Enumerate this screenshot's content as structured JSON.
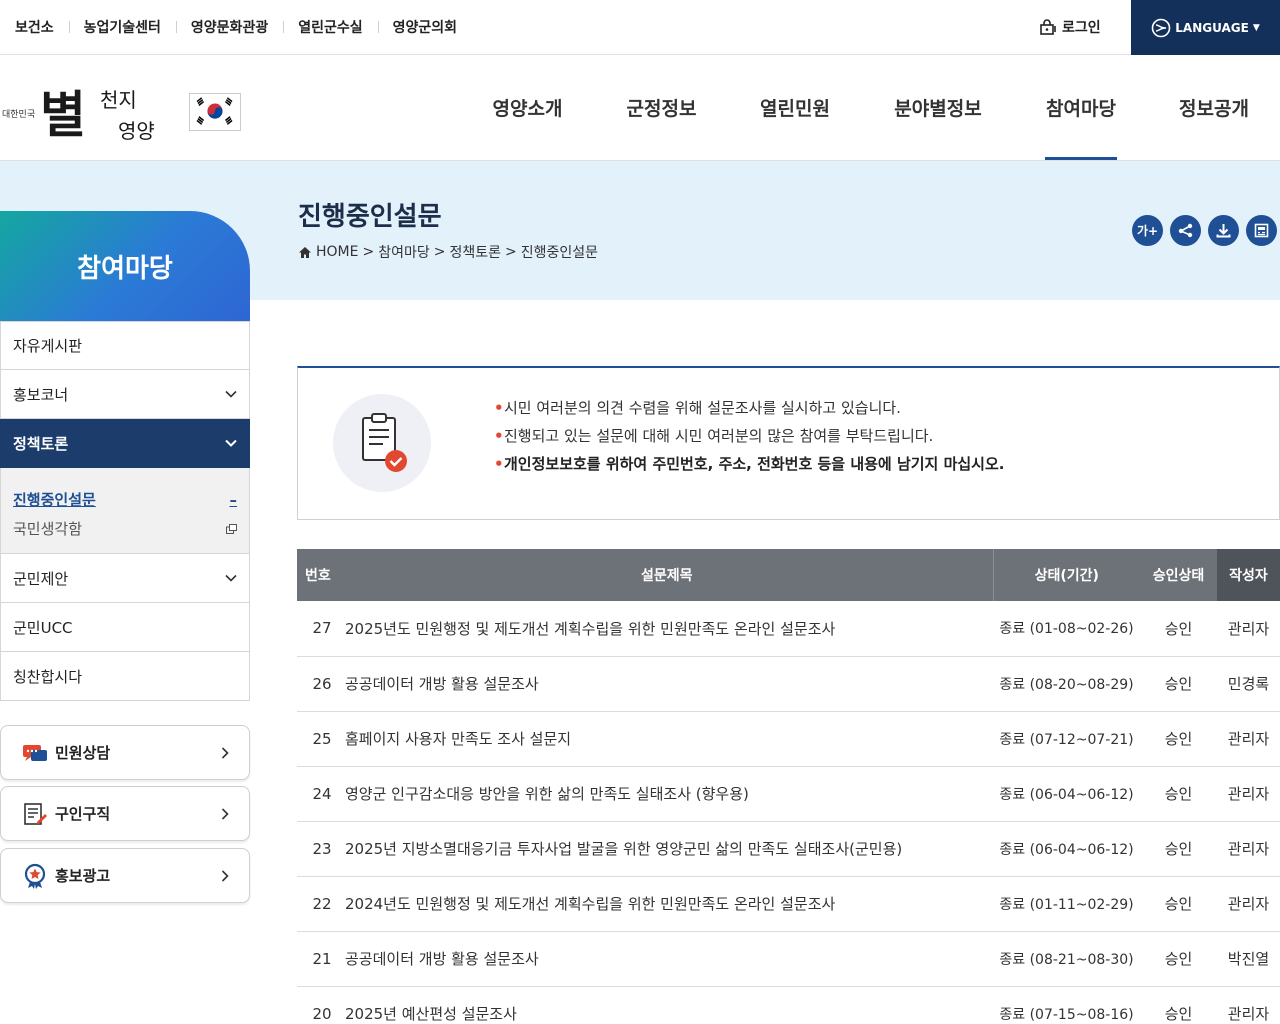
{
  "topbar": {
    "links": [
      "보건소",
      "농업기술센터",
      "영양문화관광",
      "열린군수실",
      "영양군의회"
    ],
    "login_label": "로그인",
    "language_label": "LANGUAGE"
  },
  "logo": {
    "country_text": "대한민국",
    "main_text": "별",
    "sub_text_1": "천지",
    "sub_text_2": "영양"
  },
  "gnb": {
    "items": [
      "영양소개",
      "군정정보",
      "열린민원",
      "분야별정보",
      "참여마당",
      "정보공개"
    ],
    "active_index": 4
  },
  "page": {
    "title": "진행중인설문",
    "breadcrumb": [
      "HOME",
      ">",
      "참여마당",
      ">",
      "정책토론",
      ">",
      "진행중인설문"
    ]
  },
  "tools": {
    "font_label": "가+"
  },
  "lnb": {
    "title": "참여마당",
    "items": [
      "자유게시판",
      "홍보코너",
      "정책토론",
      "군민제안",
      "군민UCC",
      "칭찬합시다"
    ],
    "active_index": 2,
    "sub_items": [
      "진행중인설문",
      "국민생각함"
    ],
    "sub_dash": "–"
  },
  "quick": {
    "items": [
      "민원상담",
      "구인구직",
      "홍보광고"
    ]
  },
  "info": {
    "lines": [
      "시민 여러분의 의견 수렴을 위해 설문조사를 실시하고 있습니다.",
      "진행되고 있는 설문에 대해 시민 여러분의 많은 참여를 부탁드립니다.",
      "개인정보보호를 위하여 주민번호, 주소, 전화번호 등을 내용에 남기지 마십시오."
    ]
  },
  "table": {
    "headers": [
      "번호",
      "설문제목",
      "상태(기간)",
      "승인상태",
      "작성자"
    ],
    "rows": [
      {
        "num": "27",
        "title": "2025년도 민원행정 및 제도개선 계획수립을 위한 민원만족도 온라인 설문조사",
        "status": "종료 (01-08~02-26)",
        "approval": "승인",
        "author": "관리자"
      },
      {
        "num": "26",
        "title": "공공데이터 개방 활용 설문조사",
        "status": "종료 (08-20~08-29)",
        "approval": "승인",
        "author": "민경록"
      },
      {
        "num": "25",
        "title": "홈페이지 사용자 만족도 조사 설문지",
        "status": "종료 (07-12~07-21)",
        "approval": "승인",
        "author": "관리자"
      },
      {
        "num": "24",
        "title": "영양군 인구감소대응 방안을 위한 삶의 만족도 실태조사 (향우용)",
        "status": "종료 (06-04~06-12)",
        "approval": "승인",
        "author": "관리자"
      },
      {
        "num": "23",
        "title": "2025년 지방소멸대응기금 투자사업 발굴을 위한 영양군민 삶의 만족도 실태조사(군민용)",
        "status": "종료 (06-04~06-12)",
        "approval": "승인",
        "author": "관리자"
      },
      {
        "num": "22",
        "title": "2024년도 민원행정 및 제도개선 계획수립을 위한 민원만족도 온라인 설문조사",
        "status": "종료 (01-11~02-29)",
        "approval": "승인",
        "author": "관리자"
      },
      {
        "num": "21",
        "title": "공공데이터 개방 활용 설문조사",
        "status": "종료 (08-21~08-30)",
        "approval": "승인",
        "author": "박진열"
      },
      {
        "num": "20",
        "title": "2025년 예산편성 설문조사",
        "status": "종료 (07-15~08-16)",
        "approval": "승인",
        "author": "관리자"
      }
    ]
  },
  "colors": {
    "navy": "#12305a",
    "primary": "#1f4f94",
    "band": "#e3f1fb",
    "table_header": "#6d7178",
    "bullet": "#e0492f"
  }
}
